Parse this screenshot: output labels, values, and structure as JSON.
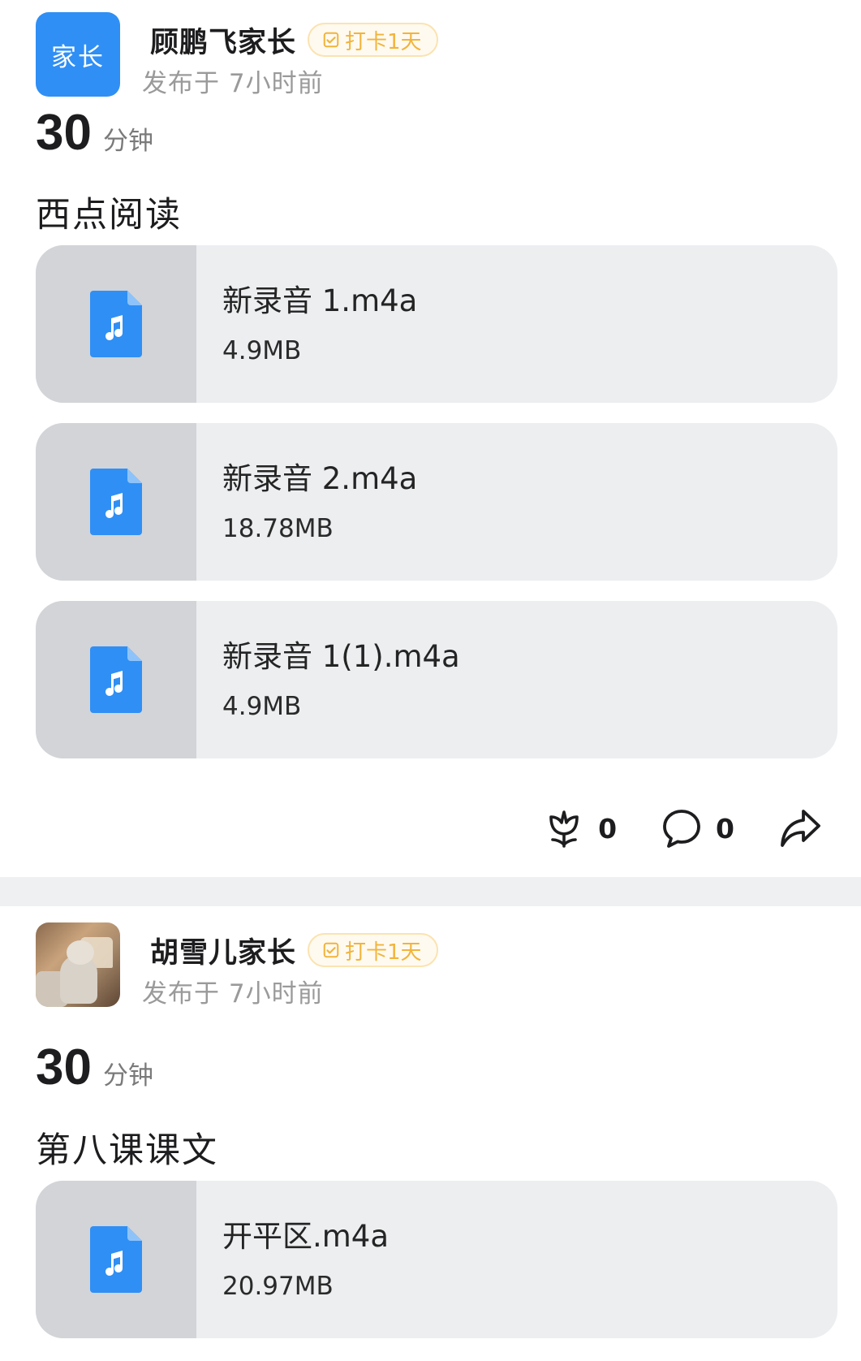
{
  "posts": [
    {
      "author": {
        "name": "顾鹏飞家长",
        "avatar_text": "家长",
        "avatar_color": "#2f8ff5"
      },
      "badge": {
        "label": "打卡1天",
        "icon": "check-square-icon",
        "color": "#f1b43b"
      },
      "time": "发布于 7小时前",
      "duration": {
        "value": "30",
        "unit": "分钟"
      },
      "title": "西点阅读",
      "files": [
        {
          "name": "新录音 1.m4a",
          "size": "4.9MB",
          "icon": "audio-file-icon"
        },
        {
          "name": "新录音 2.m4a",
          "size": "18.78MB",
          "icon": "audio-file-icon"
        },
        {
          "name": "新录音 1(1).m4a",
          "size": "4.9MB",
          "icon": "audio-file-icon"
        }
      ],
      "actions": {
        "flower": {
          "icon": "flower-icon",
          "count": "0"
        },
        "comment": {
          "icon": "comment-icon",
          "count": "0"
        },
        "share": {
          "icon": "share-icon"
        }
      }
    },
    {
      "author": {
        "name": "胡雪儿家长",
        "avatar_image": "photo-avatar"
      },
      "badge": {
        "label": "打卡1天",
        "icon": "check-square-icon",
        "color": "#f1b43b"
      },
      "time": "发布于 7小时前",
      "duration": {
        "value": "30",
        "unit": "分钟"
      },
      "title": "第八课课文",
      "files": [
        {
          "name": "开平区.m4a",
          "size": "20.97MB",
          "icon": "audio-file-icon"
        }
      ]
    }
  ],
  "colors": {
    "accent": "#2f8ff5",
    "badge_text": "#f1b43b",
    "card_bg": "#eceef0",
    "icon_panel_bg": "#d2d4d8",
    "divider": "#eff0f2"
  }
}
